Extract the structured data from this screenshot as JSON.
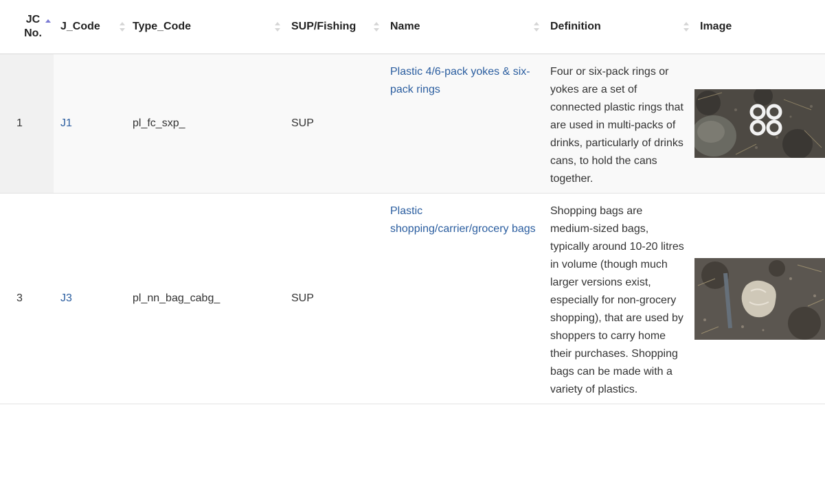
{
  "table": {
    "headers": {
      "jc_no": "JC No.",
      "j_code": "J_Code",
      "type_code": "Type_Code",
      "sup_fishing": "SUP/Fishing",
      "name": "Name",
      "definition": "Definition",
      "image": "Image"
    },
    "sort": {
      "column": "JC No.",
      "direction": "ascending"
    },
    "rows": [
      {
        "jc_no": "1",
        "j_code": "J1",
        "type_code": "pl_fc_sxp_",
        "sup_fishing": "SUP",
        "name": "Plastic 4/6-pack yokes & six-pack rings",
        "definition": "Four or six-pack rings or yokes are a set of connected plastic rings that are used in multi-packs of drinks, particularly of drinks cans, to hold the cans together.",
        "image_icon": "six-pack-rings-photo"
      },
      {
        "jc_no": "3",
        "j_code": "J3",
        "type_code": "pl_nn_bag_cabg_",
        "sup_fishing": "SUP",
        "name": "Plastic shopping/carrier/grocery bags",
        "definition": "Shopping bags are medium-sized bags, typically around 10-20 litres in volume (though much larger versions exist, especially for non-grocery shopping), that are used by shoppers to carry home their purchases. Shopping bags can be made with a variety of plastics.",
        "image_icon": "shopping-bag-photo"
      }
    ]
  },
  "colors": {
    "link": "#2a5d9f",
    "sort_active": "#7a7ad4",
    "sort_inactive": "#d6d6d6",
    "row_stripe": "#f9f9f9"
  }
}
